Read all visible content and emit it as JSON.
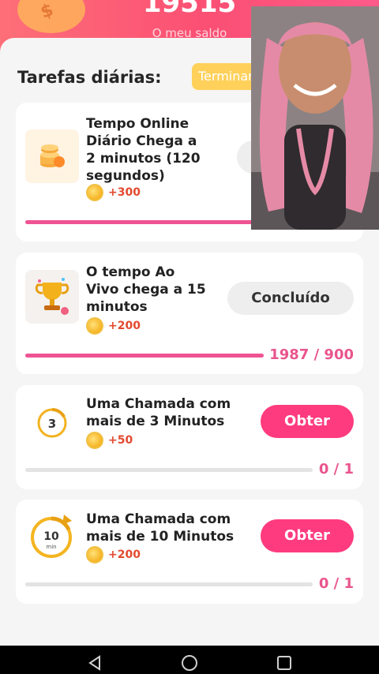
{
  "header": {
    "balance": "19515",
    "balance_label": "O meu saldo"
  },
  "section": {
    "title": "Tarefas diárias:",
    "finish_button": "Terminar"
  },
  "tasks": [
    {
      "title_lines": [
        "Tempo Online",
        "Diário Chega a",
        "2 minutos (120",
        "segundos)"
      ],
      "reward": "+300",
      "progress_fraction": 1.0
    },
    {
      "title_lines": [
        "O tempo  Ao",
        "Vivo chega a 15",
        "minutos"
      ],
      "reward": "+200",
      "action": "Concluído",
      "progress_text": "1987 / 900",
      "progress_fraction": 1.0
    },
    {
      "title_lines": [
        "Uma Chamada com",
        "mais de 3 Minutos"
      ],
      "reward": "+50",
      "action": "Obter",
      "progress_text": "0 / 1",
      "progress_fraction": 0,
      "icon_number": "3"
    },
    {
      "title_lines": [
        "Uma Chamada com",
        "mais de 10 Minutos"
      ],
      "reward": "+200",
      "action": "Obter",
      "progress_text": "0 / 1",
      "progress_fraction": 0,
      "icon_number": "10",
      "icon_unit": "min"
    }
  ],
  "colors": {
    "accent": "#fe3b7e",
    "progress": "#f05393",
    "reward": "#e24a2e"
  }
}
